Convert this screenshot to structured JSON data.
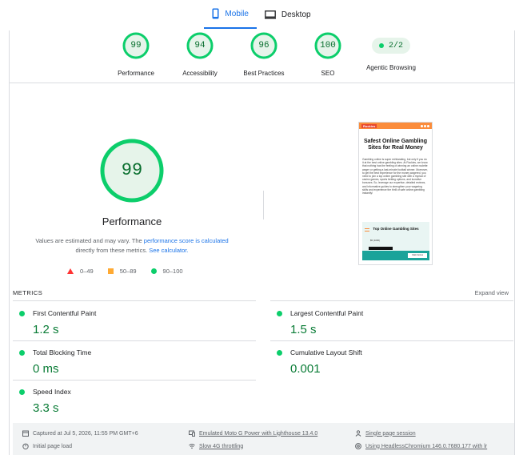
{
  "tabs": [
    {
      "label": "Mobile",
      "active": true,
      "icon": "mobile-icon"
    },
    {
      "label": "Desktop",
      "active": false,
      "icon": "desktop-icon"
    }
  ],
  "scores": [
    {
      "score": "99",
      "label": "Performance",
      "value": 99
    },
    {
      "score": "94",
      "label": "Accessibility",
      "value": 94
    },
    {
      "score": "96",
      "label": "Best Practices",
      "value": 96
    },
    {
      "score": "100",
      "label": "SEO",
      "value": 100
    }
  ],
  "agentic": {
    "value": "2/2",
    "label": "Agentic Browsing"
  },
  "performance": {
    "score": "99",
    "value": 99,
    "title": "Performance",
    "note_pre": "Values are estimated and may vary. The ",
    "note_link1": "performance score is calculated",
    "note_mid": " directly from these metrics. ",
    "note_link2": "See calculator."
  },
  "legend": [
    {
      "range": "0–49",
      "shape": "triangle",
      "color": "#ff3333"
    },
    {
      "range": "50–89",
      "shape": "square",
      "color": "#ffaa33"
    },
    {
      "range": "90–100",
      "shape": "circle",
      "color": "#0cce6b"
    }
  ],
  "thumbnail": {
    "logo": "Rockies",
    "heading": "Safest Online Gambling Sites for Real Money",
    "body": "Gambling online is super exhilarating, but only if you do it at the best online gambling sites. At Rockies, we know that nothing has the feeling of winning an online roulette wager or getting a last-minute football winner. Moreover, to get the best experience for the money wagered, you need to join a top online gambling site with a myriad of casino games, sports betting options, and lucrative bonuses. So, leverage our expertise, detailed reviews, and informative guides to strengthen your wagering skills and experience the thrill of safe online gambling instantly!",
    "box_title": "Top Online Gambling Sites",
    "box_text": "$5 (1000)",
    "button": "Claim bonus"
  },
  "metrics": {
    "heading": "METRICS",
    "expand": "Expand view",
    "items": [
      {
        "label": "First Contentful Paint",
        "value": "1.2 s"
      },
      {
        "label": "Largest Contentful Paint",
        "value": "1.5 s"
      },
      {
        "label": "Total Blocking Time",
        "value": "0 ms"
      },
      {
        "label": "Cumulative Layout Shift",
        "value": "0.001"
      },
      {
        "label": "Speed Index",
        "value": "3.3 s"
      }
    ]
  },
  "footer": {
    "captured": "Captured at Jul 5, 2026, 11:55 PM GMT+6",
    "load": "Initial page load",
    "device": "Emulated Moto G Power with Lighthouse 13.4.0",
    "throttle": "Slow 4G throttling",
    "session": "Single page session",
    "browser": "Using HeadlessChromium 146.0.7680.177 with lr"
  },
  "colors": {
    "pass": "#0cce6b",
    "pass_text": "#0a6f2f",
    "accent": "#1a73e8"
  }
}
